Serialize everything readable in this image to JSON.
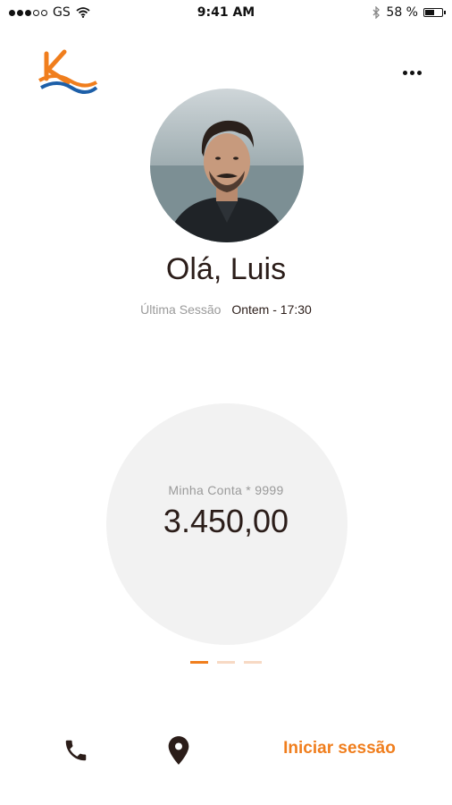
{
  "status_bar": {
    "carrier": "GS",
    "time": "9:41 AM",
    "battery_percent": "58 %",
    "battery_level": 0.58,
    "signal_filled": 3,
    "signal_total": 5
  },
  "header": {
    "logo_letter": "K",
    "menu_icon": "more-horizontal-icon"
  },
  "profile": {
    "greeting": "Olá, Luis",
    "last_session_label": "Última Sessão",
    "last_session_value": "Ontem - 17:30"
  },
  "account": {
    "label": "Minha Conta * 9999",
    "balance": "3.450,00"
  },
  "pager": {
    "count": 3,
    "active_index": 0
  },
  "bottom_bar": {
    "phone_icon": "phone-icon",
    "location_icon": "location-pin-icon",
    "login_label": "Iniciar sessão"
  },
  "colors": {
    "accent": "#f07e1d",
    "logo_blue": "#1d5fa8",
    "text_dark": "#2b1d19",
    "text_muted": "#9a9a9a",
    "circle_bg": "#f2f2f2"
  }
}
